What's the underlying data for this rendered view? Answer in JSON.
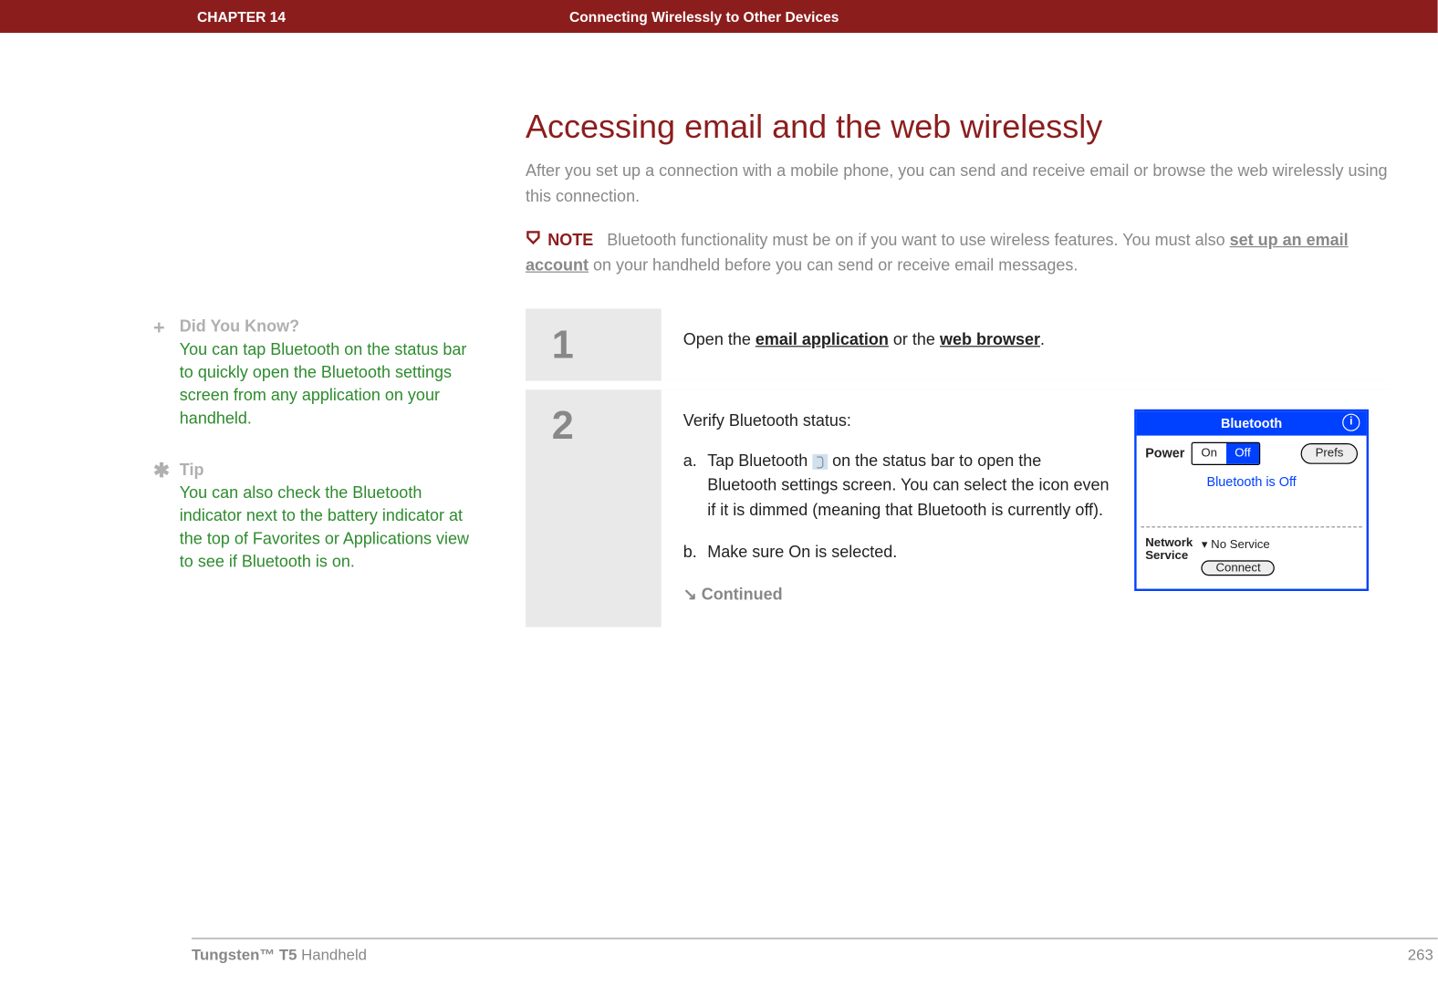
{
  "header": {
    "chapter": "CHAPTER 14",
    "title": "Connecting Wirelessly to Other Devices"
  },
  "sidebar": {
    "didyouknow": {
      "heading": "Did You Know?",
      "body": "You can tap Bluetooth on the status bar to quickly open the Bluetooth settings screen from any application on your handheld."
    },
    "tip": {
      "heading": "Tip",
      "body": "You can also check the Bluetooth indicator next to the battery indicator at the top of Favorites or Applications view to see if Bluetooth is on."
    }
  },
  "section": {
    "title": "Accessing email and the web wirelessly",
    "intro": "After you set up a connection with a mobile phone, you can send and receive email or browse the web wirelessly using this connection.",
    "note_label": "NOTE",
    "note_text_pre": "Bluetooth functionality must be on if you want to use wireless features. You must also ",
    "note_link": "set up an email account",
    "note_text_post": " on your handheld before you can send or receive email messages."
  },
  "steps": {
    "s1": {
      "num": "1",
      "pre": "Open the ",
      "link1": "email application",
      "mid": " or the ",
      "link2": "web browser",
      "post": "."
    },
    "s2": {
      "num": "2",
      "lead": "Verify Bluetooth status:",
      "a_pre": "Tap Bluetooth ",
      "a_post": " on the status bar to open the Bluetooth settings screen. You can select the icon even if it is dimmed (meaning that Bluetooth is currently off).",
      "b": "Make sure On is selected.",
      "continued": "Continued"
    }
  },
  "btpanel": {
    "title": "Bluetooth",
    "power_label": "Power",
    "on": "On",
    "off": "Off",
    "prefs": "Prefs",
    "status": "Bluetooth is Off",
    "net_label": "Network\nService",
    "net_status": "No Service",
    "connect": "Connect"
  },
  "footer": {
    "product_bold": "Tungsten™ T5",
    "product_rest": " Handheld",
    "page": "263"
  }
}
